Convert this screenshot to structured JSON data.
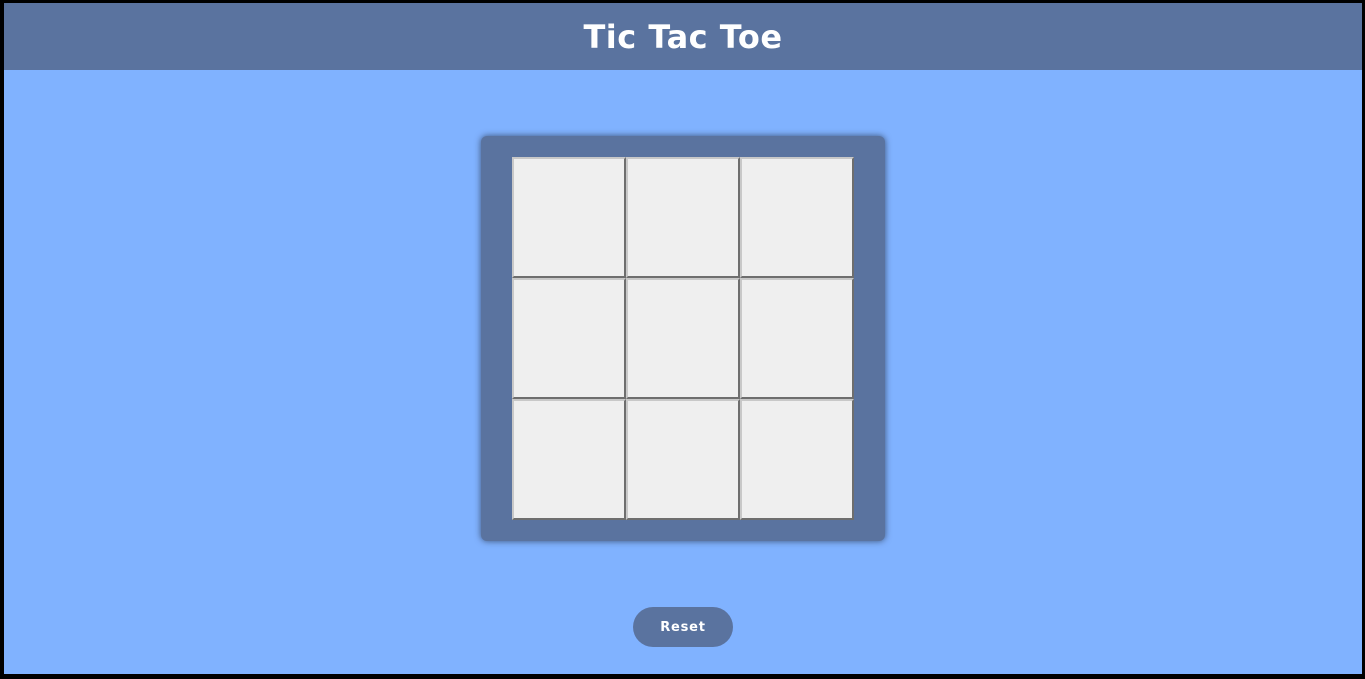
{
  "header": {
    "title": "Tic Tac Toe"
  },
  "board": {
    "cells": [
      "",
      "",
      "",
      "",
      "",
      "",
      "",
      "",
      ""
    ]
  },
  "controls": {
    "reset_label": "Reset"
  },
  "colors": {
    "background": "#80b2ff",
    "header": "#5a739f",
    "board_frame": "#5a739f",
    "cell": "#efefef",
    "button": "#5a739f",
    "text_light": "#ffffff"
  }
}
